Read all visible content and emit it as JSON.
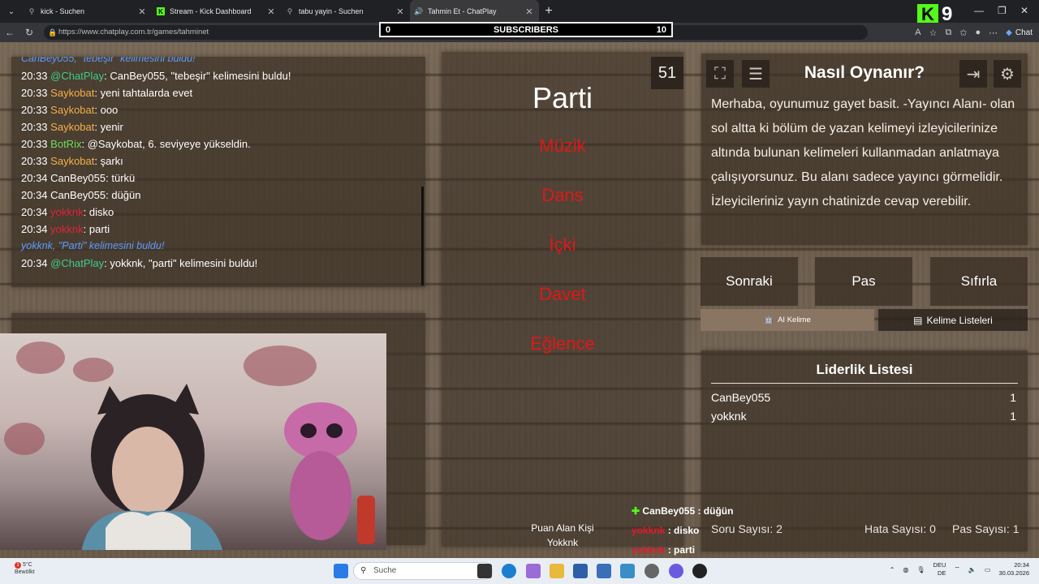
{
  "browser": {
    "tabs": [
      {
        "label": "kick - Suchen",
        "icon": "search-icon"
      },
      {
        "label": "Stream - Kick Dashboard",
        "icon": "kick-icon"
      },
      {
        "label": "tabu yayin - Suchen",
        "icon": "search-icon"
      },
      {
        "label": "Tahmin Et - ChatPlay",
        "icon": "audio-icon"
      }
    ],
    "url": "https://www.chatplay.com.tr/games/tahminet",
    "kick_count": "9",
    "chat_button": "Chat"
  },
  "subs_overlay": {
    "left": "0",
    "label": "SUBSCRIBERS",
    "right": "10"
  },
  "chat": {
    "partial_line": "CanBey055, \"tebeşir\" kelimesini buldu!",
    "lines": [
      {
        "time": "20:33",
        "user": "@ChatPlay",
        "color": "#3ecf8e",
        "text": ": CanBey055, \"tebeşir\" kelimesini buldu!"
      },
      {
        "time": "20:33",
        "user": "Saykobat",
        "color": "#f4b04a",
        "text": ": yeni tahtalarda evet"
      },
      {
        "time": "20:33",
        "user": "Saykobat",
        "color": "#f4b04a",
        "text": ": ooo"
      },
      {
        "time": "20:33",
        "user": "Saykobat",
        "color": "#f4b04a",
        "text": ": yenir"
      },
      {
        "time": "20:33",
        "user": "BotRix",
        "color": "#6fe05a",
        "text": ": @Saykobat, 6. seviyeye yükseldin."
      },
      {
        "time": "20:33",
        "user": "Saykobat",
        "color": "#f4b04a",
        "text": ": şarkı"
      },
      {
        "time": "20:34",
        "user": "CanBey055",
        "color": "#ffffff",
        "text": ": türkü"
      },
      {
        "time": "20:34",
        "user": "CanBey055",
        "color": "#ffffff",
        "text": ": düğün"
      },
      {
        "time": "20:34",
        "user": "yokknk",
        "color": "#e0243a",
        "text": ": disko"
      },
      {
        "time": "20:34",
        "user": "yokknk",
        "color": "#e0243a",
        "text": ": parti"
      }
    ],
    "system_line": "yokknk, \"Parti\" kelimesini buldu!",
    "last_line": {
      "time": "20:34",
      "user": "@ChatPlay",
      "color": "#3ecf8e",
      "text": ": yokknk, \"parti\" kelimesini buldu!"
    }
  },
  "game": {
    "timer": "51",
    "word": "Parti",
    "taboo_words": [
      "Müzik",
      "Dans",
      "İçki",
      "Davet",
      "Eğlence"
    ],
    "scorer_label": "Puan Alan Kişi",
    "scorer_name": "Yokknk"
  },
  "howto": {
    "title": "Nasıl Oynanır?",
    "text": "Merhaba, oyunumuz gayet basit. -Yayıncı Alanı- olan sol altta ki bölüm de yazan kelimeyi izleyicilerinize altında bulunan kelimeleri kullanmadan anlatmaya çalışıyorsunuz. Bu alanı sadece yayıncı görmelidir. İzleyicileriniz yayın chatinizde cevap verebilir."
  },
  "controls": {
    "next": "Sonraki",
    "pass": "Pas",
    "reset": "Sıfırla",
    "ai_word": "AI Kelime",
    "word_lists": "Kelime Listeleri"
  },
  "leaderboard": {
    "title": "Liderlik Listesi",
    "rows": [
      {
        "name": "CanBey055",
        "score": "1"
      },
      {
        "name": "yokknk",
        "score": "1"
      }
    ]
  },
  "stats": {
    "questions": "Soru Sayısı: 2",
    "errors": "Hata Sayısı: 0",
    "passes": "Pas Sayısı: 1"
  },
  "stream_overlay": [
    {
      "user": "CanBey055",
      "text": " : düğün",
      "style": "green"
    },
    {
      "user": "yokknk",
      "text": " : disko",
      "style": "red"
    },
    {
      "user": "yokknk",
      "text": " : parti",
      "style": "red"
    }
  ],
  "taskbar": {
    "weather_temp": "5°C",
    "weather_desc": "Bewölkt",
    "notif": "1",
    "search_placeholder": "Suche",
    "lang1": "DEU",
    "lang2": "DE",
    "time": "20:34",
    "date": "30.03.2026"
  }
}
